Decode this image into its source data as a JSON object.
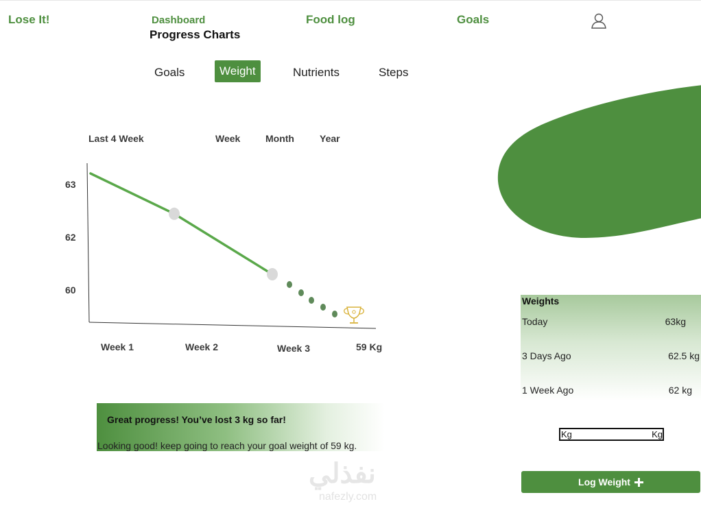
{
  "header": {
    "brand": "Lose It!",
    "nav_dashboard": "Dashboard",
    "page_title": "Progress Charts",
    "nav_food_log": "Food log",
    "nav_goals": "Goals",
    "profile_icon": "user-icon"
  },
  "tabs": [
    {
      "label": "Goals",
      "active": false
    },
    {
      "label": "Weight",
      "active": true
    },
    {
      "label": "Nutrients",
      "active": false
    },
    {
      "label": "Steps",
      "active": false
    }
  ],
  "range": {
    "current": "Last 4 Week",
    "options": [
      "Week",
      "Month",
      "Year"
    ]
  },
  "chart_data": {
    "type": "line",
    "categories": [
      "Week 1",
      "Week 2",
      "Week 3",
      "59 Kg"
    ],
    "y_ticks": [
      "63",
      "62",
      "60"
    ],
    "series": [
      {
        "values": [
          63.2,
          62.4,
          61.2
        ]
      }
    ],
    "goal_marker_icon": "trophy-icon",
    "colors": {
      "line": "#5aa84a",
      "point": "#d9d9d9",
      "projection": "#5f8a5a"
    }
  },
  "banner": {
    "title": "Great progress! You’ve lost 3 kg so far!",
    "text": "Looking good! keep going to reach your goal weight of 59 kg."
  },
  "weights": {
    "title": "Weights",
    "rows": [
      {
        "label": "Today",
        "value": "63kg"
      },
      {
        "label": "3 Days Ago",
        "value": "62.5 kg"
      },
      {
        "label": "1 Week Ago",
        "value": "62 kg"
      }
    ]
  },
  "input": {
    "left_unit": "Kg",
    "right_unit": "Kg"
  },
  "log_button": {
    "label": "Log Weight",
    "icon": "plus-icon"
  },
  "watermark": {
    "arabic": "نفذلي",
    "latin": "nafezly.com"
  },
  "colors": {
    "accent": "#4e8f3f"
  }
}
